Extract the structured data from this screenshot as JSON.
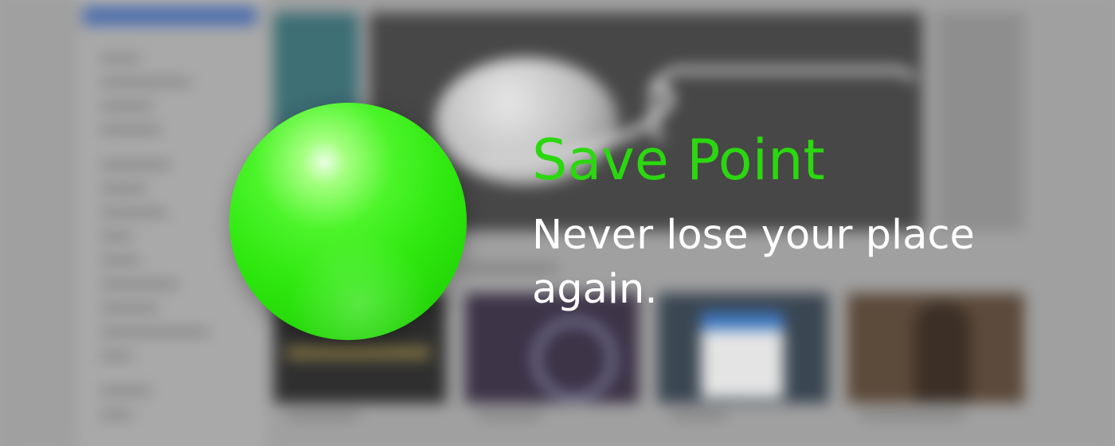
{
  "banner": {
    "title": "Save Point",
    "tagline": "Never lose your place again.",
    "colors": {
      "title": "#2bd80f",
      "tagline": "#ffffff",
      "orb": "#2ee80e",
      "background": "#a3a3a3"
    },
    "icon": "green-orb-icon"
  }
}
